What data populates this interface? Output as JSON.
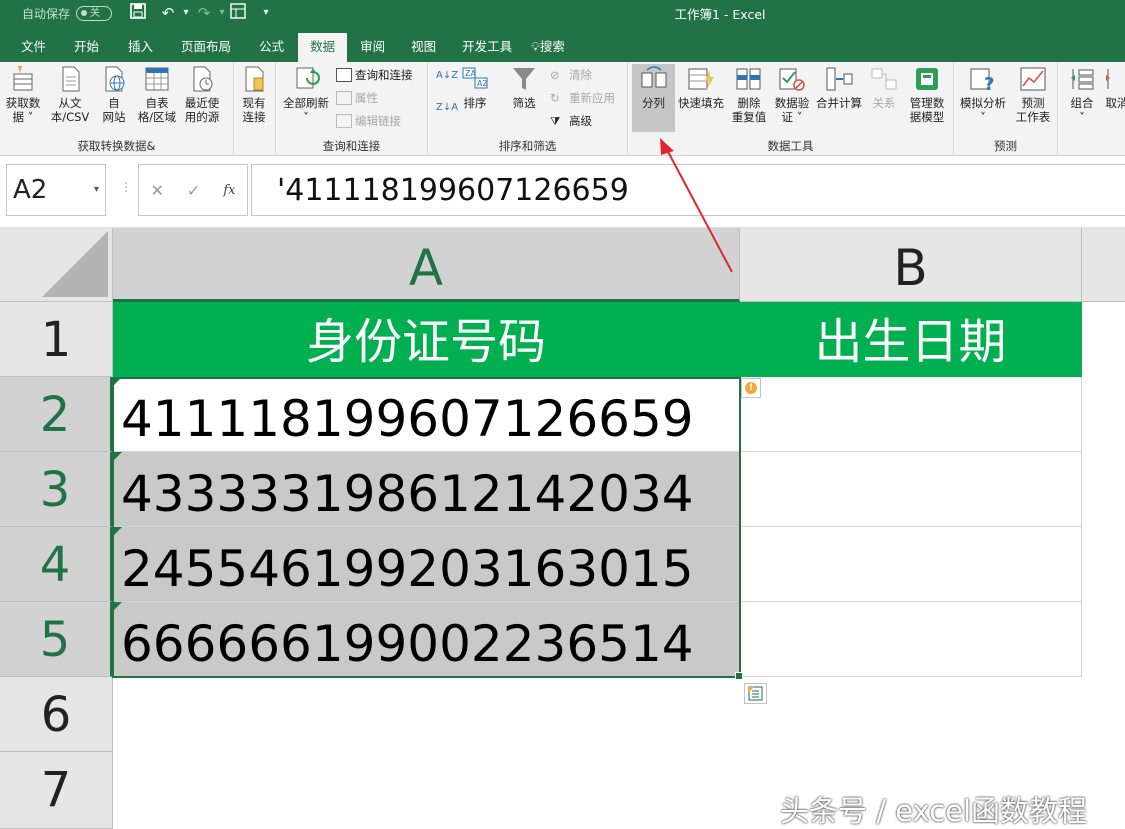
{
  "titlebar": {
    "autosave_label": "自动保存",
    "autosave_state": "关",
    "doc_title": "工作簿1  -  Excel",
    "accent": "#217346"
  },
  "tabs": [
    "文件",
    "开始",
    "插入",
    "页面布局",
    "公式",
    "数据",
    "审阅",
    "视图",
    "开发工具",
    "搜索"
  ],
  "active_tab": "数据",
  "ribbon": {
    "groups": {
      "get": "获取转换数据&",
      "query": "查询和连接",
      "sort": "排序和筛选",
      "tools": "数据工具",
      "forecast": "预测"
    },
    "get_buttons": [
      {
        "l1": "获取数",
        "l2": "据 ˅",
        "icon": "database-icon"
      },
      {
        "l1": "从文",
        "l2": "本/CSV",
        "icon": "text-file-icon"
      },
      {
        "l1": "自",
        "l2": "网站",
        "icon": "web-icon"
      },
      {
        "l1": "自表",
        "l2": "格/区域",
        "icon": "table-icon"
      },
      {
        "l1": "最近使",
        "l2": "用的源",
        "icon": "recent-icon"
      },
      {
        "l1": "现有",
        "l2": "连接",
        "icon": "connection-icon"
      }
    ],
    "query": {
      "refresh_l1": "全部刷新",
      "refresh_l2": "˅",
      "items": [
        "查询和连接",
        "属性",
        "编辑链接"
      ]
    },
    "sort": {
      "sort_label": "排序",
      "filter_label": "筛选",
      "clear": "清除",
      "reapply": "重新应用",
      "advanced": "高级"
    },
    "tools": [
      {
        "l1": "分列",
        "l2": "",
        "icon": "text-to-columns-icon"
      },
      {
        "l1": "快速填充",
        "l2": "",
        "icon": "flash-fill-icon"
      },
      {
        "l1": "删除",
        "l2": "重复值",
        "icon": "remove-duplicates-icon"
      },
      {
        "l1": "数据验",
        "l2": "证 ˅",
        "icon": "data-validation-icon"
      },
      {
        "l1": "合并计算",
        "l2": "",
        "icon": "consolidate-icon"
      },
      {
        "l1": "关系",
        "l2": "",
        "icon": "relationships-icon"
      },
      {
        "l1": "管理数",
        "l2": "据模型",
        "icon": "data-model-icon"
      }
    ],
    "forecast": [
      {
        "l1": "模拟分析",
        "l2": "˅",
        "icon": "what-if-icon"
      },
      {
        "l1": "预测",
        "l2": "工作表",
        "icon": "forecast-sheet-icon"
      }
    ],
    "outline": [
      {
        "l1": "组合",
        "l2": "˅"
      },
      {
        "l1": "取消",
        "l2": ""
      }
    ]
  },
  "formula_bar": {
    "name_box": "A2",
    "formula": "'411118199607126659"
  },
  "sheet": {
    "columns": [
      "A",
      "B"
    ],
    "rows": [
      "1",
      "2",
      "3",
      "4",
      "5",
      "6",
      "7"
    ],
    "header_row": [
      "身份证号码",
      "出生日期"
    ],
    "ids": [
      "411118199607126659",
      "433333198612142034",
      "245546199203163015",
      "666666199002236514"
    ],
    "header_fill": "#00b050",
    "selection_fill": "#c9c9c9"
  },
  "watermark": "头条号 / excel函数教程"
}
